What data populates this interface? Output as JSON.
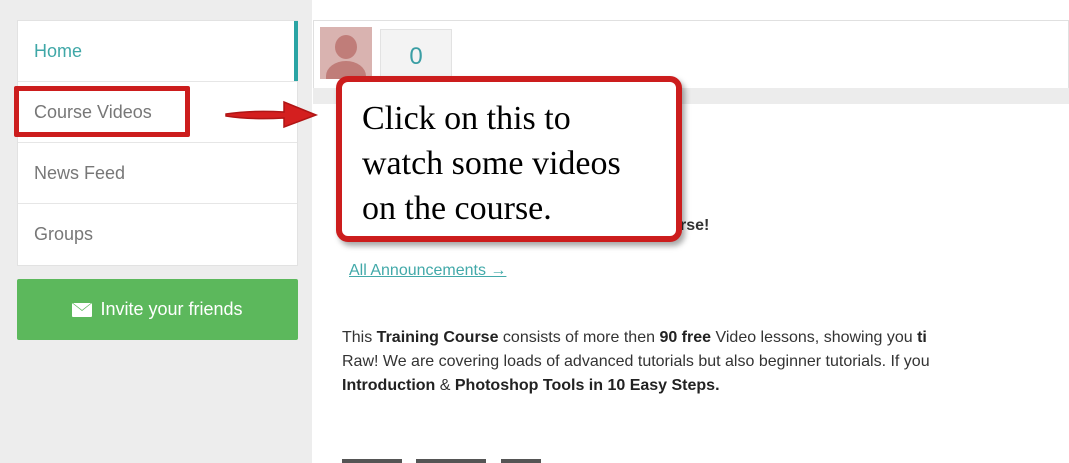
{
  "sidebar": {
    "items": [
      {
        "label": "Home",
        "active": true
      },
      {
        "label": "Course Videos",
        "active": false
      },
      {
        "label": "News Feed",
        "active": false
      },
      {
        "label": "Groups",
        "active": false
      }
    ],
    "invite_button": {
      "label": "Invite your friends",
      "icon": "envelope-icon"
    }
  },
  "header": {
    "avatar_icon": "user-avatar-icon",
    "count": "0"
  },
  "callout": {
    "lines": [
      "Click on this to",
      "watch some videos",
      "on the course."
    ]
  },
  "main": {
    "partial_heading_text": "rse!",
    "announcements_link": "All Announcements →",
    "paragraph": {
      "line1_prefix": "This ",
      "line1_bold1": "Training Course",
      "line1_mid": " consists of more then ",
      "line1_bold2": "90 free",
      "line1_suffix": " Video lessons, showing you ",
      "line1_bold3": "ti",
      "line2": "Raw! We are covering loads of advanced tutorials but also beginner tutorials. If you",
      "line3_bold1": "Introduction",
      "line3_mid": " & ",
      "line3_bold2": "Photoshop Tools in 10 Easy Steps."
    }
  },
  "colors": {
    "accent_teal": "#3fa7a7",
    "invite_green": "#5cb85c",
    "annotation_red": "#cc1d1d"
  }
}
